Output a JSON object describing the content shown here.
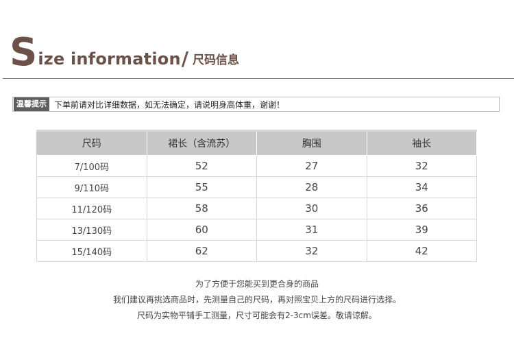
{
  "header": {
    "title_big_letter": "S",
    "title_rest": "ize information",
    "title_slash": "/",
    "title_cn": "尺码信息"
  },
  "tip": {
    "tag": "温馨提示",
    "text": "下单前请对比详细数据，如无法确定，请说明身高体重，谢谢！"
  },
  "table": {
    "headers": [
      "尺码",
      "裙长（含流苏）",
      "胸围",
      "袖长"
    ],
    "rows": [
      [
        "7/100码",
        "52",
        "27",
        "32"
      ],
      [
        "9/110码",
        "55",
        "28",
        "34"
      ],
      [
        "11/120码",
        "58",
        "30",
        "36"
      ],
      [
        "13/130码",
        "60",
        "31",
        "39"
      ],
      [
        "15/140码",
        "62",
        "32",
        "42"
      ]
    ]
  },
  "notes": [
    "为了方便于您能买到更合身的商品",
    "我们建议再挑选商品时，先测量自己的尺码，再对照宝贝上方的尺码进行选择。",
    "尺码为实物平铺手工测量，尺寸可能会有2-3cm误差。敬请谅解。"
  ],
  "colors": {
    "title": "#6b5147",
    "tag_bg": "#5e5e5e",
    "header_bg": "#c8c8c8"
  }
}
